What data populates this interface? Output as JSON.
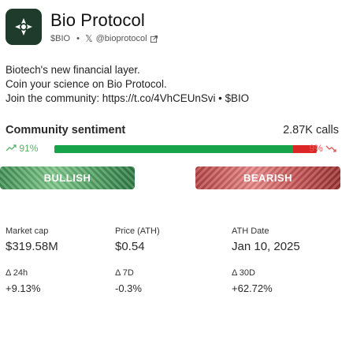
{
  "header": {
    "name": "Bio Protocol",
    "ticker": "$BIO",
    "separator": "•",
    "x_icon": "x-logo-icon",
    "handle": "@bioprotocol",
    "external_icon": "external-link-icon"
  },
  "description": {
    "lines": [
      "Biotech's new financial layer.",
      "Coin your science on Bio Protocol.",
      "Join the community: https://t.co/4VhCEUnSvi • $BIO"
    ]
  },
  "sentiment": {
    "title": "Community sentiment",
    "calls": "2.87K calls",
    "bullish_pct_label": "91%",
    "bearish_pct_label": "9%",
    "bullish_fraction": 0.91,
    "bearish_fraction": 0.09,
    "bullish_icon": "trend-up-icon",
    "bearish_icon": "trend-down-icon",
    "bullish_button": "BULLISH",
    "bearish_button": "BEARISH",
    "colors": {
      "bull": "#16a34a",
      "bear": "#dc2626"
    }
  },
  "stats": {
    "market_cap": {
      "label": "Market cap",
      "value": "$319.58M"
    },
    "price": {
      "label": "Price (ATH)",
      "value": "$0.54"
    },
    "ath_date": {
      "label": "ATH Date",
      "value": "Jan 10, 2025"
    },
    "change_24h": {
      "label": "Δ 24h",
      "value": "+9.13%"
    },
    "change_7d": {
      "label": "Δ 7D",
      "value": "-0.3%"
    },
    "change_30d": {
      "label": "Δ 30D",
      "value": "+62.72%"
    }
  }
}
